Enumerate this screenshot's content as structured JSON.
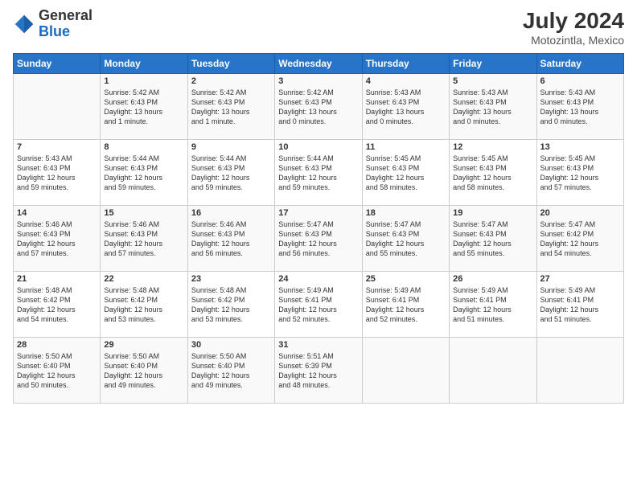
{
  "header": {
    "logo_general": "General",
    "logo_blue": "Blue",
    "month_year": "July 2024",
    "location": "Motozintla, Mexico"
  },
  "days_of_week": [
    "Sunday",
    "Monday",
    "Tuesday",
    "Wednesday",
    "Thursday",
    "Friday",
    "Saturday"
  ],
  "weeks": [
    [
      {
        "day": "",
        "info": ""
      },
      {
        "day": "1",
        "info": "Sunrise: 5:42 AM\nSunset: 6:43 PM\nDaylight: 13 hours\nand 1 minute."
      },
      {
        "day": "2",
        "info": "Sunrise: 5:42 AM\nSunset: 6:43 PM\nDaylight: 13 hours\nand 1 minute."
      },
      {
        "day": "3",
        "info": "Sunrise: 5:42 AM\nSunset: 6:43 PM\nDaylight: 13 hours\nand 0 minutes."
      },
      {
        "day": "4",
        "info": "Sunrise: 5:43 AM\nSunset: 6:43 PM\nDaylight: 13 hours\nand 0 minutes."
      },
      {
        "day": "5",
        "info": "Sunrise: 5:43 AM\nSunset: 6:43 PM\nDaylight: 13 hours\nand 0 minutes."
      },
      {
        "day": "6",
        "info": "Sunrise: 5:43 AM\nSunset: 6:43 PM\nDaylight: 13 hours\nand 0 minutes."
      }
    ],
    [
      {
        "day": "7",
        "info": "Sunrise: 5:43 AM\nSunset: 6:43 PM\nDaylight: 12 hours\nand 59 minutes."
      },
      {
        "day": "8",
        "info": "Sunrise: 5:44 AM\nSunset: 6:43 PM\nDaylight: 12 hours\nand 59 minutes."
      },
      {
        "day": "9",
        "info": "Sunrise: 5:44 AM\nSunset: 6:43 PM\nDaylight: 12 hours\nand 59 minutes."
      },
      {
        "day": "10",
        "info": "Sunrise: 5:44 AM\nSunset: 6:43 PM\nDaylight: 12 hours\nand 59 minutes."
      },
      {
        "day": "11",
        "info": "Sunrise: 5:45 AM\nSunset: 6:43 PM\nDaylight: 12 hours\nand 58 minutes."
      },
      {
        "day": "12",
        "info": "Sunrise: 5:45 AM\nSunset: 6:43 PM\nDaylight: 12 hours\nand 58 minutes."
      },
      {
        "day": "13",
        "info": "Sunrise: 5:45 AM\nSunset: 6:43 PM\nDaylight: 12 hours\nand 57 minutes."
      }
    ],
    [
      {
        "day": "14",
        "info": "Sunrise: 5:46 AM\nSunset: 6:43 PM\nDaylight: 12 hours\nand 57 minutes."
      },
      {
        "day": "15",
        "info": "Sunrise: 5:46 AM\nSunset: 6:43 PM\nDaylight: 12 hours\nand 57 minutes."
      },
      {
        "day": "16",
        "info": "Sunrise: 5:46 AM\nSunset: 6:43 PM\nDaylight: 12 hours\nand 56 minutes."
      },
      {
        "day": "17",
        "info": "Sunrise: 5:47 AM\nSunset: 6:43 PM\nDaylight: 12 hours\nand 56 minutes."
      },
      {
        "day": "18",
        "info": "Sunrise: 5:47 AM\nSunset: 6:43 PM\nDaylight: 12 hours\nand 55 minutes."
      },
      {
        "day": "19",
        "info": "Sunrise: 5:47 AM\nSunset: 6:43 PM\nDaylight: 12 hours\nand 55 minutes."
      },
      {
        "day": "20",
        "info": "Sunrise: 5:47 AM\nSunset: 6:42 PM\nDaylight: 12 hours\nand 54 minutes."
      }
    ],
    [
      {
        "day": "21",
        "info": "Sunrise: 5:48 AM\nSunset: 6:42 PM\nDaylight: 12 hours\nand 54 minutes."
      },
      {
        "day": "22",
        "info": "Sunrise: 5:48 AM\nSunset: 6:42 PM\nDaylight: 12 hours\nand 53 minutes."
      },
      {
        "day": "23",
        "info": "Sunrise: 5:48 AM\nSunset: 6:42 PM\nDaylight: 12 hours\nand 53 minutes."
      },
      {
        "day": "24",
        "info": "Sunrise: 5:49 AM\nSunset: 6:41 PM\nDaylight: 12 hours\nand 52 minutes."
      },
      {
        "day": "25",
        "info": "Sunrise: 5:49 AM\nSunset: 6:41 PM\nDaylight: 12 hours\nand 52 minutes."
      },
      {
        "day": "26",
        "info": "Sunrise: 5:49 AM\nSunset: 6:41 PM\nDaylight: 12 hours\nand 51 minutes."
      },
      {
        "day": "27",
        "info": "Sunrise: 5:49 AM\nSunset: 6:41 PM\nDaylight: 12 hours\nand 51 minutes."
      }
    ],
    [
      {
        "day": "28",
        "info": "Sunrise: 5:50 AM\nSunset: 6:40 PM\nDaylight: 12 hours\nand 50 minutes."
      },
      {
        "day": "29",
        "info": "Sunrise: 5:50 AM\nSunset: 6:40 PM\nDaylight: 12 hours\nand 49 minutes."
      },
      {
        "day": "30",
        "info": "Sunrise: 5:50 AM\nSunset: 6:40 PM\nDaylight: 12 hours\nand 49 minutes."
      },
      {
        "day": "31",
        "info": "Sunrise: 5:51 AM\nSunset: 6:39 PM\nDaylight: 12 hours\nand 48 minutes."
      },
      {
        "day": "",
        "info": ""
      },
      {
        "day": "",
        "info": ""
      },
      {
        "day": "",
        "info": ""
      }
    ]
  ]
}
